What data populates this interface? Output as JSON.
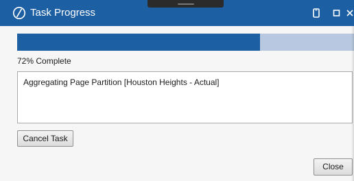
{
  "window": {
    "title": "Task Progress",
    "titlebar_color": "#1c5fa3",
    "title_icon": "app-logo-icon",
    "controls": [
      "phone-icon",
      "maximize-icon",
      "close-icon"
    ]
  },
  "progress": {
    "fraction": 0.72,
    "label": "72% Complete",
    "fill_color": "#1c5fa3",
    "track_color": "#b7c8e0"
  },
  "status": {
    "message": "Aggregating Page Partition [Houston Heights - Actual]"
  },
  "buttons": {
    "cancel_label": "Cancel Task",
    "close_label": "Close"
  }
}
